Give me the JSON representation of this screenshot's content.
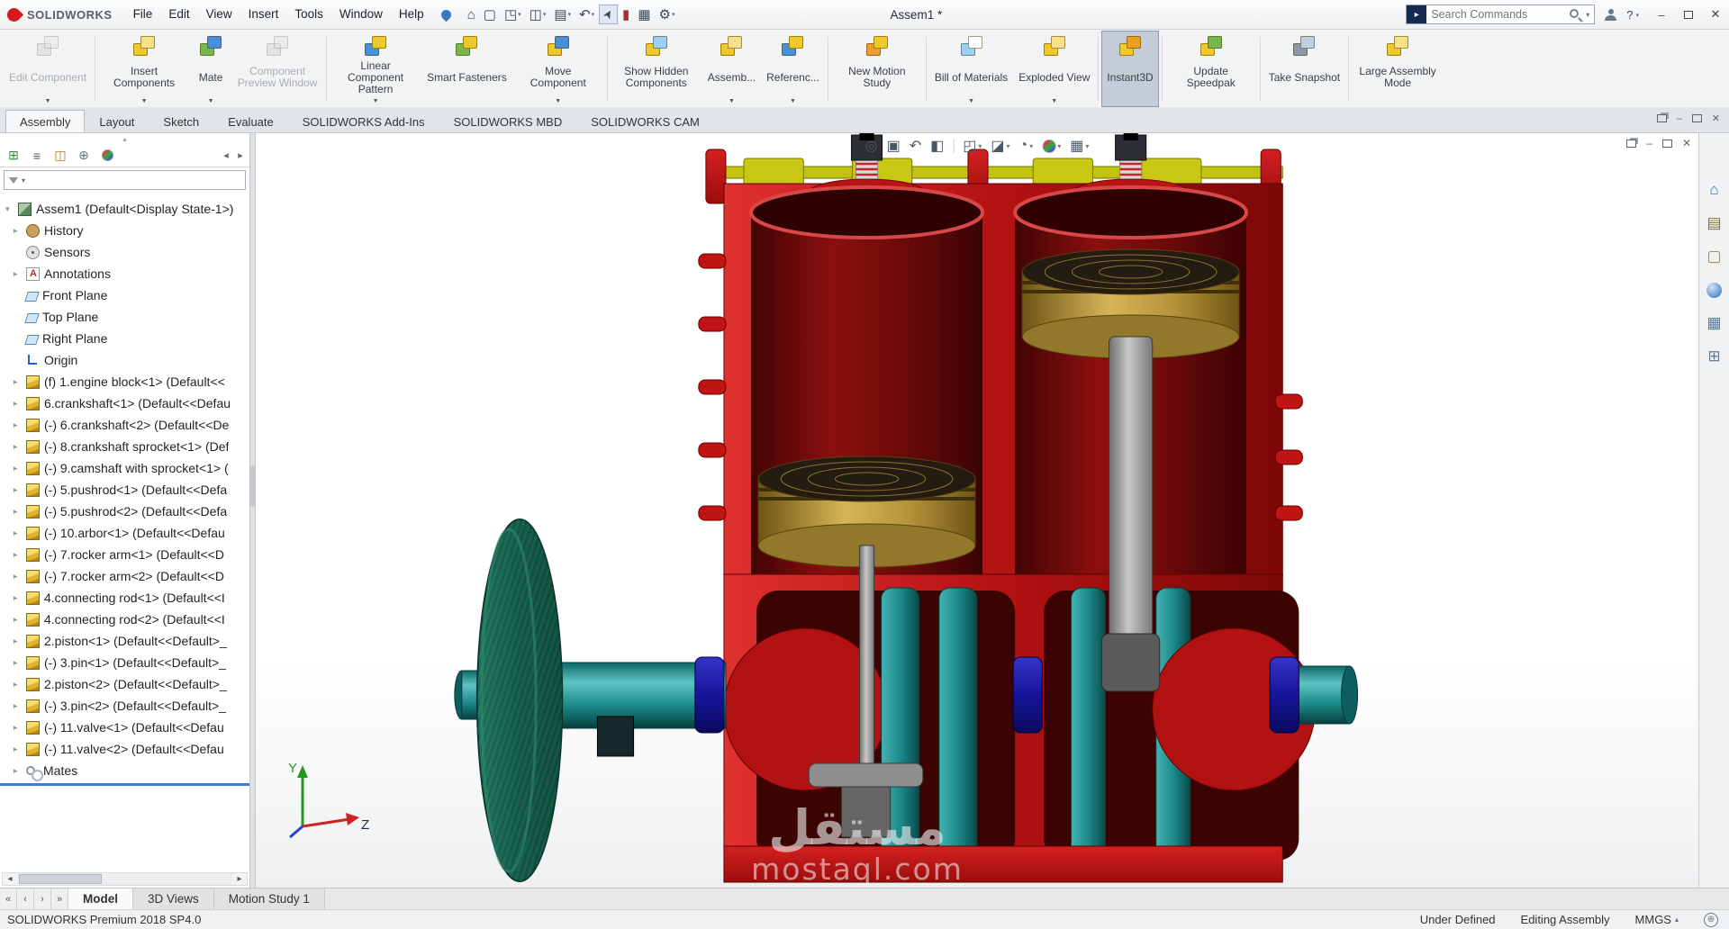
{
  "window": {
    "title": "Assem1 *",
    "brand": "SOLIDWORKS",
    "menu": [
      "File",
      "Edit",
      "View",
      "Insert",
      "Tools",
      "Window",
      "Help"
    ],
    "search_placeholder": "Search Commands"
  },
  "qat": [
    {
      "name": "home"
    },
    {
      "name": "new-document"
    },
    {
      "name": "open",
      "caret": true
    },
    {
      "name": "save",
      "caret": true
    },
    {
      "name": "print",
      "caret": true
    },
    {
      "name": "undo",
      "caret": true
    },
    {
      "name": "select",
      "selected": true
    },
    {
      "name": "component-state"
    },
    {
      "name": "view-grid"
    },
    {
      "name": "options",
      "caret": true
    }
  ],
  "ribbon": {
    "tabs": [
      {
        "label": "Assembly",
        "active": true
      },
      {
        "label": "Layout"
      },
      {
        "label": "Sketch"
      },
      {
        "label": "Evaluate"
      },
      {
        "label": "SOLIDWORKS Add-Ins"
      },
      {
        "label": "SOLIDWORKS MBD"
      },
      {
        "label": "SOLIDWORKS CAM"
      }
    ],
    "buttons": [
      {
        "label": "Edit Component",
        "disabled": true,
        "caret": true,
        "c1": "#c9c9c9",
        "c2": "#e2e2e2",
        "sep": true
      },
      {
        "label": "Insert Components",
        "caret": true,
        "c1": "#f0c829",
        "c2": "#f7e08a"
      },
      {
        "label": "Mate",
        "caret": true,
        "c1": "#74b84c",
        "c2": "#4a90d9"
      },
      {
        "label": "Component Preview Window",
        "disabled": true,
        "c1": "#c9c9c9",
        "c2": "#e2e2e2",
        "sep": true
      },
      {
        "label": "Linear Component Pattern",
        "caret": true,
        "c1": "#4a90d9",
        "c2": "#f0c829"
      },
      {
        "label": "Smart Fasteners",
        "c1": "#74b84c",
        "c2": "#f0c829"
      },
      {
        "label": "Move Component",
        "caret": true,
        "c1": "#f0c829",
        "c2": "#4a90d9",
        "sep": true
      },
      {
        "label": "Show Hidden Components",
        "c1": "#f0c829",
        "c2": "#9ad0f5"
      },
      {
        "label": "Assemb...",
        "caret": true,
        "c1": "#f0c829",
        "c2": "#f7e08a"
      },
      {
        "label": "Referenc...",
        "caret": true,
        "c1": "#4a90d9",
        "c2": "#f0c829",
        "sep": true
      },
      {
        "label": "New Motion Study",
        "c1": "#f29b30",
        "c2": "#f0c829",
        "sep": true
      },
      {
        "label": "Bill of Materials",
        "caret": true,
        "c1": "#9ad0f5",
        "c2": "#ffffff"
      },
      {
        "label": "Exploded View",
        "caret": true,
        "c1": "#f0c829",
        "c2": "#f7e08a",
        "sep": true
      },
      {
        "label": "Instant3D",
        "active": true,
        "c1": "#f0c829",
        "c2": "#e8a020",
        "sep": true
      },
      {
        "label": "Update Speedpak",
        "c1": "#f0c829",
        "c2": "#74b84c",
        "sep": true
      },
      {
        "label": "Take Snapshot",
        "c1": "#8899aa",
        "c2": "#c0d0e0",
        "sep": true
      },
      {
        "label": "Large Assembly Mode",
        "c1": "#f0c829",
        "c2": "#f7e08a"
      }
    ]
  },
  "panel_tabs": [
    {
      "name": "featuremanager-design-tree"
    },
    {
      "name": "propertymanager"
    },
    {
      "name": "configurationmanager"
    },
    {
      "name": "dimxpertmanager"
    },
    {
      "name": "displaymanager"
    }
  ],
  "feature_tree": {
    "root": "Assem1 (Default<Display State-1>)",
    "items": [
      {
        "label": "History",
        "icon": "history",
        "arrow": true
      },
      {
        "label": "Sensors",
        "icon": "sensors",
        "arrow": false
      },
      {
        "label": "Annotations",
        "icon": "annotations",
        "arrow": true
      },
      {
        "label": "Front Plane",
        "icon": "plane",
        "arrow": false
      },
      {
        "label": "Top Plane",
        "icon": "plane",
        "arrow": false
      },
      {
        "label": "Right Plane",
        "icon": "plane",
        "arrow": false
      },
      {
        "label": "Origin",
        "icon": "origin",
        "arrow": false
      },
      {
        "label": "(f) 1.engine block<1> (Default<<",
        "icon": "part",
        "arrow": true
      },
      {
        "label": "6.crankshaft<1> (Default<<Defau",
        "icon": "part",
        "arrow": true
      },
      {
        "label": "(-) 6.crankshaft<2> (Default<<De",
        "icon": "part",
        "arrow": true
      },
      {
        "label": "(-) 8.crankshaft sprocket<1> (Def",
        "icon": "part",
        "arrow": true
      },
      {
        "label": "(-) 9.camshaft with sprocket<1> (",
        "icon": "part",
        "arrow": true
      },
      {
        "label": "(-) 5.pushrod<1> (Default<<Defa",
        "icon": "part",
        "arrow": true
      },
      {
        "label": "(-) 5.pushrod<2> (Default<<Defa",
        "icon": "part",
        "arrow": true
      },
      {
        "label": "(-) 10.arbor<1> (Default<<Defau",
        "icon": "part",
        "arrow": true
      },
      {
        "label": "(-) 7.rocker arm<1> (Default<<D",
        "icon": "part",
        "arrow": true
      },
      {
        "label": "(-) 7.rocker arm<2> (Default<<D",
        "icon": "part",
        "arrow": true
      },
      {
        "label": "4.connecting rod<1> (Default<<I",
        "icon": "part",
        "arrow": true
      },
      {
        "label": "4.connecting rod<2> (Default<<I",
        "icon": "part",
        "arrow": true
      },
      {
        "label": "2.piston<1> (Default<<Default>_",
        "icon": "part",
        "arrow": true
      },
      {
        "label": "(-) 3.pin<1> (Default<<Default>_",
        "icon": "part",
        "arrow": true
      },
      {
        "label": "2.piston<2> (Default<<Default>_",
        "icon": "part",
        "arrow": true
      },
      {
        "label": "(-) 3.pin<2> (Default<<Default>_",
        "icon": "part",
        "arrow": true
      },
      {
        "label": "(-) 11.valve<1> (Default<<Defau",
        "icon": "part",
        "arrow": true
      },
      {
        "label": "(-) 11.valve<2> (Default<<Defau",
        "icon": "part",
        "arrow": true
      },
      {
        "label": "Mates",
        "icon": "mates",
        "arrow": true
      }
    ]
  },
  "viewport": {
    "headsup": [
      {
        "name": "zoom-fit"
      },
      {
        "name": "zoom-area"
      },
      {
        "name": "previous-view"
      },
      {
        "name": "section-view"
      },
      {
        "name": "sep"
      },
      {
        "name": "view-orientation",
        "caret": true
      },
      {
        "name": "display-style",
        "caret": true
      },
      {
        "name": "hide-show-items",
        "caret": true
      },
      {
        "name": "edit-appearance",
        "caret": true
      },
      {
        "name": "view-settings",
        "caret": true
      }
    ],
    "watermark_line1": "مستقل",
    "watermark_line2": "mostaql.com",
    "triad_y": "Y",
    "triad_z": "Z"
  },
  "task_pane": [
    {
      "name": "home"
    },
    {
      "name": "design-library"
    },
    {
      "name": "file-explorer"
    },
    {
      "name": "appearances"
    },
    {
      "name": "view-palette"
    },
    {
      "name": "custom-properties"
    }
  ],
  "bottom_tabs": [
    {
      "label": "Model",
      "active": true
    },
    {
      "label": "3D Views"
    },
    {
      "label": "Motion Study 1"
    }
  ],
  "statusbar": {
    "left": "SOLIDWORKS Premium 2018 SP4.0",
    "status": "Under Defined",
    "mode": "Editing Assembly",
    "units": "MMGS"
  }
}
